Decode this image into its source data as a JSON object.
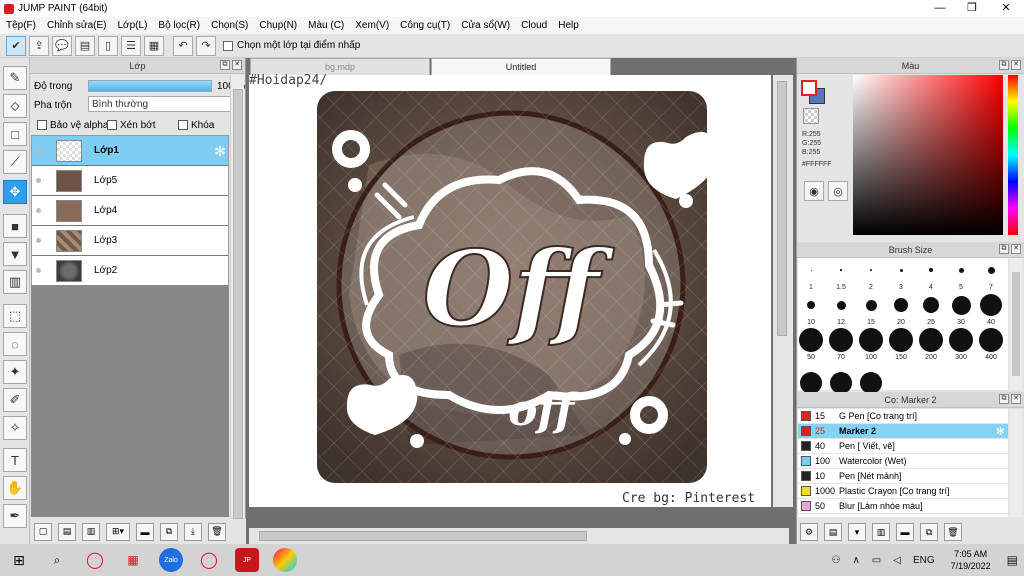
{
  "window": {
    "title": "JUMP PAINT (64bit)",
    "minimize": "—",
    "restore": "❐",
    "close": "✕"
  },
  "menu": [
    "Tệp(F)",
    "Chỉnh sửa(E)",
    "Lớp(L)",
    "Bộ lọc(R)",
    "Chọn(S)",
    "Chụp(N)",
    "Màu (C)",
    "Xem(V)",
    "Công cụ(T)",
    "Cửa sổ(W)",
    "Cloud",
    "Help"
  ],
  "toolbar": {
    "sample_label": "Chọn một lớp tại điểm nhấp"
  },
  "layer_panel": {
    "title": "Lớp",
    "opacity_label": "Độ trong",
    "opacity_value": "100 %",
    "opacity_fraction": 1.0,
    "blend_label": "Pha trộn",
    "blend_value": "Bình thường",
    "protect_alpha": "Bảo vệ alpha",
    "clipping": "Xén bớt",
    "lock": "Khóa",
    "layers": [
      {
        "name": "Lớp1",
        "selected": true
      },
      {
        "name": "Lớp5",
        "selected": false
      },
      {
        "name": "Lớp4",
        "selected": false
      },
      {
        "name": "Lớp3",
        "selected": false
      },
      {
        "name": "Lớp2",
        "selected": false
      }
    ]
  },
  "tabs": [
    {
      "label": "bg.mdp",
      "active": false
    },
    {
      "label": "Untitled",
      "active": true
    }
  ],
  "canvas": {
    "watermark_top": "#Hoidap24/",
    "watermark_bottom": "Cre bg: Pinterest",
    "big_text": "Off",
    "small_text": "off"
  },
  "color_panel": {
    "title": "Màu",
    "r": "R:255",
    "g": "G:255",
    "b": "B:255",
    "hex": "#FFFFFF",
    "foreground": "#ffffff",
    "background": "#5577bb"
  },
  "brush_panel": {
    "title": "Brush Size",
    "sizes": [
      "1",
      "1.5",
      "2",
      "3",
      "4",
      "5",
      "7",
      "10",
      "12",
      "15",
      "20",
      "25",
      "30",
      "40",
      "50",
      "70",
      "100",
      "150",
      "200",
      "300",
      "400"
    ]
  },
  "marker_panel": {
    "title": "Cọ: Marker 2",
    "items": [
      {
        "size": "15",
        "name": "G Pen [Cọ trang trí]",
        "color": "#e02020",
        "selected": false
      },
      {
        "size": "25",
        "name": "Marker 2",
        "color": "#e02020",
        "selected": true
      },
      {
        "size": "40",
        "name": "Pen [ Viết, vẽ]",
        "color": "#222222",
        "selected": false
      },
      {
        "size": "100",
        "name": "Watercolor (Wet)",
        "color": "#6fd3f2",
        "selected": false
      },
      {
        "size": "10",
        "name": "Pen [Nét mảnh]",
        "color": "#222222",
        "selected": false
      },
      {
        "size": "1000",
        "name": "Plastic Crayon [Cọ trang trí]",
        "color": "#f2e020",
        "selected": false
      },
      {
        "size": "50",
        "name": "Blur [Làm nhòe màu]",
        "color": "#f0a0d8",
        "selected": false
      }
    ]
  },
  "taskbar": {
    "lang": "ENG",
    "time": "7:05 AM",
    "date": "7/19/2022"
  }
}
